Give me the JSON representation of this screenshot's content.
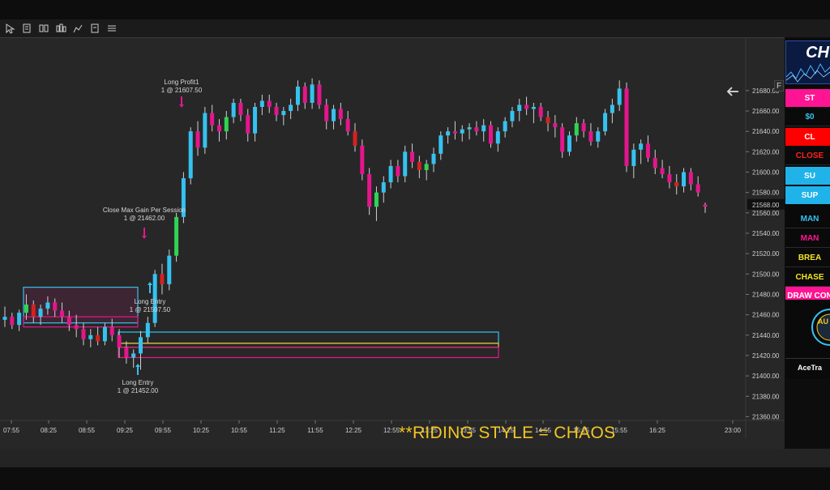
{
  "toolbar": {
    "icons": [
      "cursor-icon",
      "properties-icon",
      "drawing-tools-icon",
      "indicators-icon",
      "strategy-icon",
      "template-icon",
      "list-icon"
    ]
  },
  "chart_frame": {
    "f_button": "F",
    "caption": "**RIDING STYLE = CHAOS",
    "current_price": "21568.00"
  },
  "colors": {
    "up": "#35c2f0",
    "down": "#e4168c",
    "up_alt": "#2fd454",
    "down_alt": "#d22222",
    "wick": "#d0d0d0",
    "price_axis_bg": "#272727",
    "accent": "#f3c623"
  },
  "chart_data": {
    "type": "candlestick",
    "ylim": [
      21350,
      21695
    ],
    "y_ticks": [
      "21680.00",
      "21660.00",
      "21640.00",
      "21620.00",
      "21600.00",
      "21580.00",
      "21560.00",
      "21540.00",
      "21520.00",
      "21500.00",
      "21480.00",
      "21460.00",
      "21440.00",
      "21420.00",
      "21400.00",
      "21380.00",
      "21360.00"
    ],
    "x_ticks": [
      "07:55",
      "08:25",
      "08:55",
      "09:25",
      "09:55",
      "10:25",
      "10:55",
      "11:25",
      "11:55",
      "12:25",
      "12:55",
      "13:25",
      "13:55",
      "14:25",
      "14:55",
      "15:25",
      "15:55",
      "16:25",
      "23:00"
    ],
    "candles": [
      [
        21455,
        21468,
        21448,
        21458
      ],
      [
        21458,
        21462,
        21446,
        21450
      ],
      [
        21450,
        21465,
        21444,
        21462
      ],
      [
        21462,
        21480,
        21455,
        21470
      ],
      [
        21470,
        21474,
        21452,
        21458
      ],
      [
        21458,
        21470,
        21450,
        21466
      ],
      [
        21466,
        21478,
        21460,
        21472
      ],
      [
        21472,
        21476,
        21458,
        21464
      ],
      [
        21464,
        21472,
        21452,
        21458
      ],
      [
        21458,
        21464,
        21444,
        21450
      ],
      [
        21450,
        21460,
        21438,
        21446
      ],
      [
        21446,
        21452,
        21430,
        21436
      ],
      [
        21436,
        21446,
        21428,
        21440
      ],
      [
        21440,
        21448,
        21430,
        21434
      ],
      [
        21434,
        21452,
        21430,
        21448
      ],
      [
        21448,
        21456,
        21434,
        21440
      ],
      [
        21440,
        21446,
        21418,
        21428
      ],
      [
        21428,
        21434,
        21412,
        21418
      ],
      [
        21418,
        21426,
        21408,
        21422
      ],
      [
        21422,
        21444,
        21406,
        21438
      ],
      [
        21438,
        21458,
        21432,
        21452
      ],
      [
        21452,
        21504,
        21448,
        21500
      ],
      [
        21500,
        21510,
        21480,
        21490
      ],
      [
        21490,
        21524,
        21484,
        21518
      ],
      [
        21518,
        21560,
        21512,
        21556
      ],
      [
        21556,
        21600,
        21550,
        21594
      ],
      [
        21594,
        21644,
        21588,
        21640
      ],
      [
        21640,
        21650,
        21616,
        21624
      ],
      [
        21624,
        21664,
        21618,
        21658
      ],
      [
        21658,
        21666,
        21640,
        21646
      ],
      [
        21646,
        21652,
        21630,
        21640
      ],
      [
        21640,
        21660,
        21632,
        21654
      ],
      [
        21654,
        21672,
        21648,
        21668
      ],
      [
        21668,
        21672,
        21650,
        21656
      ],
      [
        21656,
        21662,
        21630,
        21638
      ],
      [
        21638,
        21668,
        21630,
        21664
      ],
      [
        21664,
        21676,
        21656,
        21670
      ],
      [
        21670,
        21676,
        21658,
        21664
      ],
      [
        21664,
        21668,
        21650,
        21656
      ],
      [
        21656,
        21664,
        21646,
        21660
      ],
      [
        21660,
        21672,
        21652,
        21666
      ],
      [
        21666,
        21690,
        21660,
        21684
      ],
      [
        21684,
        21688,
        21662,
        21668
      ],
      [
        21668,
        21692,
        21662,
        21686
      ],
      [
        21686,
        21690,
        21662,
        21666
      ],
      [
        21666,
        21672,
        21642,
        21650
      ],
      [
        21650,
        21666,
        21642,
        21662
      ],
      [
        21662,
        21668,
        21646,
        21652
      ],
      [
        21652,
        21660,
        21636,
        21640
      ],
      [
        21640,
        21648,
        21620,
        21626
      ],
      [
        21626,
        21632,
        21592,
        21598
      ],
      [
        21598,
        21604,
        21558,
        21566
      ],
      [
        21566,
        21586,
        21552,
        21580
      ],
      [
        21580,
        21596,
        21570,
        21590
      ],
      [
        21590,
        21612,
        21584,
        21606
      ],
      [
        21606,
        21612,
        21590,
        21596
      ],
      [
        21596,
        21626,
        21590,
        21620
      ],
      [
        21620,
        21628,
        21604,
        21610
      ],
      [
        21610,
        21616,
        21594,
        21602
      ],
      [
        21602,
        21612,
        21592,
        21608
      ],
      [
        21608,
        21624,
        21600,
        21618
      ],
      [
        21618,
        21640,
        21612,
        21636
      ],
      [
        21636,
        21644,
        21628,
        21640
      ],
      [
        21640,
        21650,
        21632,
        21638
      ],
      [
        21638,
        21646,
        21630,
        21642
      ],
      [
        21642,
        21648,
        21632,
        21644
      ],
      [
        21644,
        21650,
        21636,
        21640
      ],
      [
        21640,
        21652,
        21630,
        21646
      ],
      [
        21646,
        21650,
        21624,
        21628
      ],
      [
        21628,
        21644,
        21620,
        21640
      ],
      [
        21640,
        21654,
        21634,
        21650
      ],
      [
        21650,
        21664,
        21644,
        21660
      ],
      [
        21660,
        21672,
        21650,
        21666
      ],
      [
        21666,
        21674,
        21656,
        21662
      ],
      [
        21662,
        21668,
        21648,
        21664
      ],
      [
        21664,
        21668,
        21650,
        21654
      ],
      [
        21654,
        21660,
        21640,
        21648
      ],
      [
        21648,
        21656,
        21634,
        21644
      ],
      [
        21644,
        21648,
        21614,
        21620
      ],
      [
        21620,
        21640,
        21616,
        21636
      ],
      [
        21636,
        21654,
        21630,
        21648
      ],
      [
        21648,
        21652,
        21634,
        21640
      ],
      [
        21640,
        21648,
        21626,
        21630
      ],
      [
        21630,
        21644,
        21624,
        21640
      ],
      [
        21640,
        21662,
        21636,
        21658
      ],
      [
        21658,
        21672,
        21648,
        21666
      ],
      [
        21666,
        21690,
        21660,
        21682
      ],
      [
        21682,
        21688,
        21600,
        21606
      ],
      [
        21606,
        21628,
        21594,
        21622
      ],
      [
        21622,
        21632,
        21608,
        21628
      ],
      [
        21628,
        21636,
        21610,
        21614
      ],
      [
        21614,
        21622,
        21598,
        21604
      ],
      [
        21604,
        21612,
        21594,
        21598
      ],
      [
        21598,
        21606,
        21584,
        21590
      ],
      [
        21590,
        21598,
        21578,
        21586
      ],
      [
        21586,
        21604,
        21580,
        21600
      ],
      [
        21600,
        21604,
        21582,
        21588
      ],
      [
        21588,
        21596,
        21576,
        21580
      ],
      [
        21568,
        21570,
        21560,
        21566
      ]
    ],
    "annotations": [
      {
        "label": "Long Profit1",
        "sub": "1 @ 21607.50",
        "type": "exit"
      },
      {
        "label": "Close Max Gain Per Session",
        "sub": "1 @ 21462.00",
        "type": "exit"
      },
      {
        "label": "Long  Entry",
        "sub": "1 @ 21507.50",
        "type": "entry"
      },
      {
        "label": "Long  Entry",
        "sub": "1 @ 21452.00",
        "type": "entry"
      }
    ],
    "zones": [
      {
        "name": "supply-zone",
        "y_top": 21487,
        "y_bottom": 21452,
        "color": "#35c2f0"
      },
      {
        "name": "mag-zone-1",
        "y_top": 21458,
        "y_bottom": 21448,
        "color": "#e4168c"
      },
      {
        "name": "demand-zone-blue",
        "y_top": 21443,
        "y_bottom": 21432,
        "color": "#35c2f0"
      },
      {
        "name": "demand-zone-yellow",
        "y_top": 21432,
        "y_bottom": 21428,
        "color": "#f3c623"
      },
      {
        "name": "demand-zone-pink",
        "y_top": 21428,
        "y_bottom": 21418,
        "color": "#e4168c"
      }
    ]
  },
  "panel": {
    "logo": "CH",
    "buttons": [
      {
        "label": "ST",
        "bg": "#ff1493",
        "fg": "#ffffff"
      },
      {
        "label": "$0",
        "bg": "#0a0a0a",
        "fg": "#35c2f0"
      },
      {
        "label": "CL",
        "bg": "#ff0000",
        "fg": "#ffffff"
      },
      {
        "label": "CLOSE",
        "bg": "#0a0a0a",
        "fg": "#ff2020"
      },
      {
        "label": "SU",
        "bg": "#1fb3ea",
        "fg": "#ffffff"
      },
      {
        "label": "SUP",
        "bg": "#1fb3ea",
        "fg": "#ffffff"
      },
      {
        "label": "MAN",
        "bg": "#0a0a0a",
        "fg": "#35c2f0"
      },
      {
        "label": "MAN",
        "bg": "#0a0a0a",
        "fg": "#ff1493"
      },
      {
        "label": "BREA",
        "bg": "#0a0a0a",
        "fg": "#f3e623"
      },
      {
        "label": "CHASE",
        "bg": "#0a0a0a",
        "fg": "#f3e623"
      },
      {
        "label": "DRAW CON",
        "bg": "#ff1493",
        "fg": "#ffffff"
      }
    ],
    "badge_text": "AU",
    "footer_text": "AceTra"
  }
}
